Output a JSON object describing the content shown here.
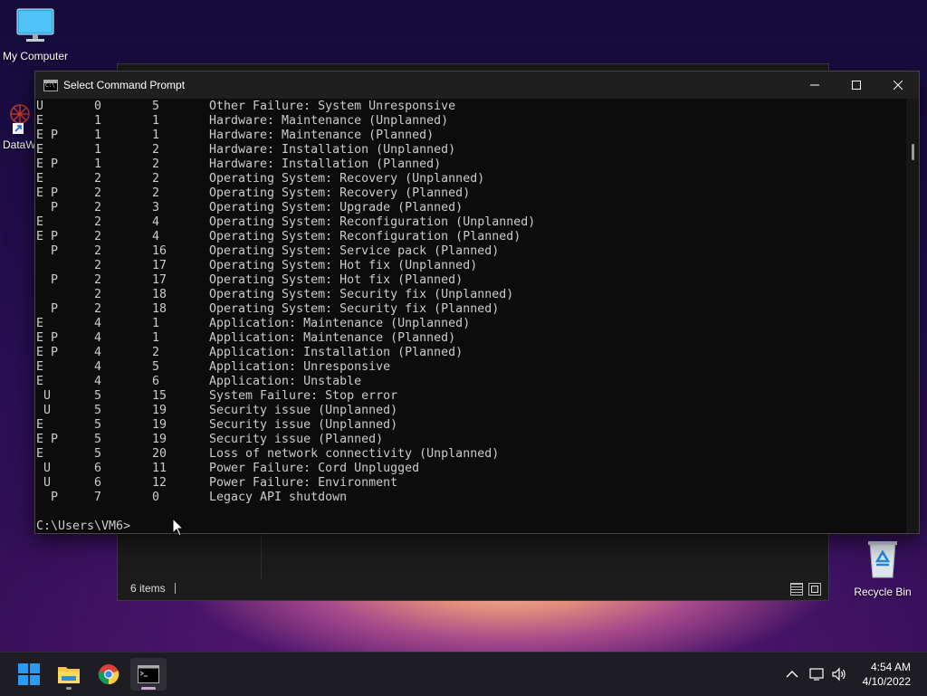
{
  "desktop": {
    "icons": [
      {
        "label": "My Computer"
      },
      {
        "label": "DataW"
      },
      {
        "label": "Recycle Bin"
      }
    ]
  },
  "explorer": {
    "status_count": "6 items"
  },
  "cmd": {
    "title": "Select Command Prompt",
    "rows": [
      {
        "flags": "U",
        "major": "0",
        "minor": "5",
        "reason": "Other Failure: System Unresponsive"
      },
      {
        "flags": "E",
        "major": "1",
        "minor": "1",
        "reason": "Hardware: Maintenance (Unplanned)"
      },
      {
        "flags": "E P",
        "major": "1",
        "minor": "1",
        "reason": "Hardware: Maintenance (Planned)"
      },
      {
        "flags": "E",
        "major": "1",
        "minor": "2",
        "reason": "Hardware: Installation (Unplanned)"
      },
      {
        "flags": "E P",
        "major": "1",
        "minor": "2",
        "reason": "Hardware: Installation (Planned)"
      },
      {
        "flags": "E",
        "major": "2",
        "minor": "2",
        "reason": "Operating System: Recovery (Unplanned)"
      },
      {
        "flags": "E P",
        "major": "2",
        "minor": "2",
        "reason": "Operating System: Recovery (Planned)"
      },
      {
        "flags": "  P",
        "major": "2",
        "minor": "3",
        "reason": "Operating System: Upgrade (Planned)"
      },
      {
        "flags": "E",
        "major": "2",
        "minor": "4",
        "reason": "Operating System: Reconfiguration (Unplanned)"
      },
      {
        "flags": "E P",
        "major": "2",
        "minor": "4",
        "reason": "Operating System: Reconfiguration (Planned)"
      },
      {
        "flags": "  P",
        "major": "2",
        "minor": "16",
        "reason": "Operating System: Service pack (Planned)"
      },
      {
        "flags": "",
        "major": "2",
        "minor": "17",
        "reason": "Operating System: Hot fix (Unplanned)"
      },
      {
        "flags": "  P",
        "major": "2",
        "minor": "17",
        "reason": "Operating System: Hot fix (Planned)"
      },
      {
        "flags": "",
        "major": "2",
        "minor": "18",
        "reason": "Operating System: Security fix (Unplanned)"
      },
      {
        "flags": "  P",
        "major": "2",
        "minor": "18",
        "reason": "Operating System: Security fix (Planned)"
      },
      {
        "flags": "E",
        "major": "4",
        "minor": "1",
        "reason": "Application: Maintenance (Unplanned)"
      },
      {
        "flags": "E P",
        "major": "4",
        "minor": "1",
        "reason": "Application: Maintenance (Planned)"
      },
      {
        "flags": "E P",
        "major": "4",
        "minor": "2",
        "reason": "Application: Installation (Planned)"
      },
      {
        "flags": "E",
        "major": "4",
        "minor": "5",
        "reason": "Application: Unresponsive"
      },
      {
        "flags": "E",
        "major": "4",
        "minor": "6",
        "reason": "Application: Unstable"
      },
      {
        "flags": " U",
        "major": "5",
        "minor": "15",
        "reason": "System Failure: Stop error"
      },
      {
        "flags": " U",
        "major": "5",
        "minor": "19",
        "reason": "Security issue (Unplanned)"
      },
      {
        "flags": "E",
        "major": "5",
        "minor": "19",
        "reason": "Security issue (Unplanned)"
      },
      {
        "flags": "E P",
        "major": "5",
        "minor": "19",
        "reason": "Security issue (Planned)"
      },
      {
        "flags": "E",
        "major": "5",
        "minor": "20",
        "reason": "Loss of network connectivity (Unplanned)"
      },
      {
        "flags": " U",
        "major": "6",
        "minor": "11",
        "reason": "Power Failure: Cord Unplugged"
      },
      {
        "flags": " U",
        "major": "6",
        "minor": "12",
        "reason": "Power Failure: Environment"
      },
      {
        "flags": "  P",
        "major": "7",
        "minor": "0",
        "reason": "Legacy API shutdown"
      }
    ],
    "prompt": "C:\\Users\\VM6>"
  },
  "taskbar": {
    "apps": [
      "start-icon",
      "file-explorer-icon",
      "chrome-icon",
      "terminal-icon"
    ],
    "clock_time": "4:54 AM",
    "clock_date": "4/10/2022"
  },
  "colors": {
    "console_bg": "#0c0c0c",
    "console_text": "#cccccc",
    "titlebar_bg": "#1f1f1f",
    "taskbar_bg": "#1e1d24",
    "accent_blue": "#2b9af3"
  }
}
